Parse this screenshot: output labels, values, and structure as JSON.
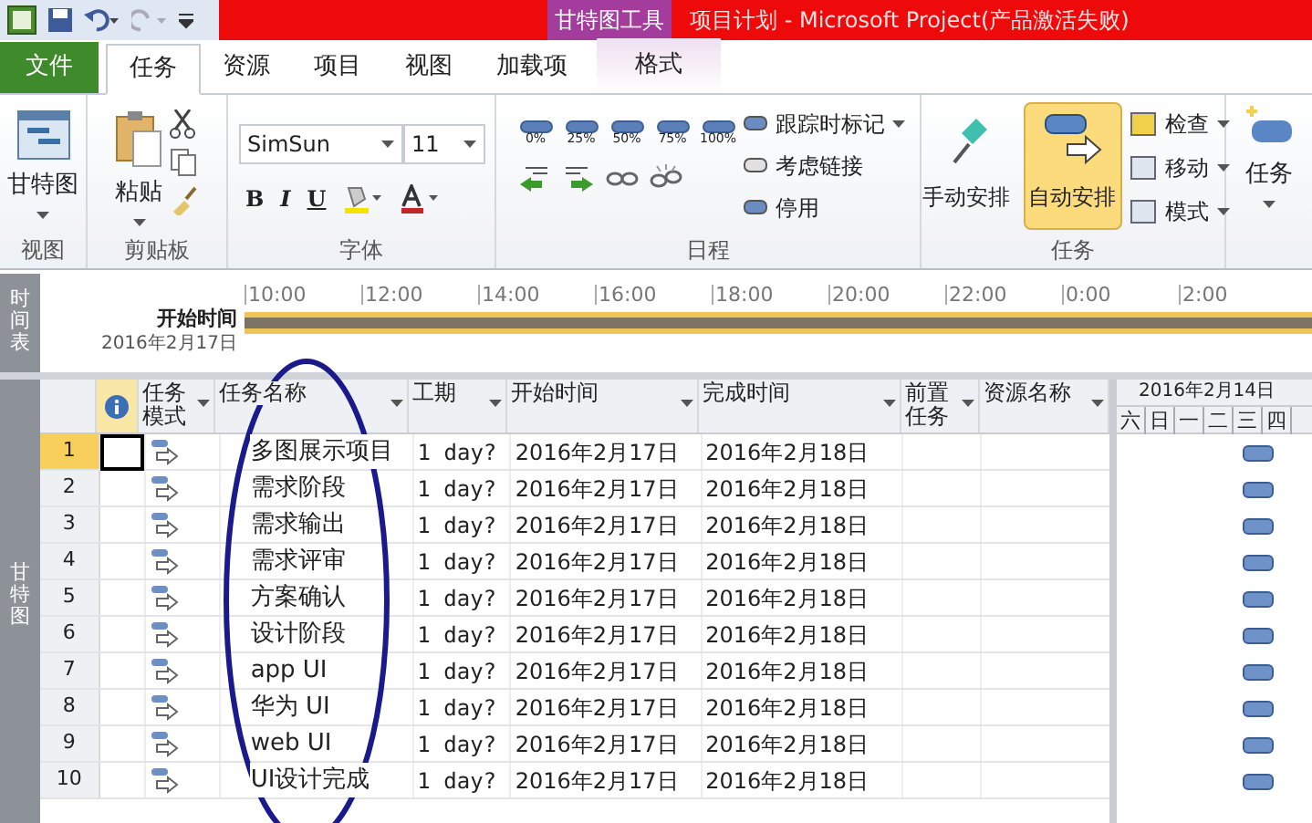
{
  "window": {
    "tool_tab": "甘特图工具",
    "title": "项目计划 - Microsoft Project(产品激活失败)"
  },
  "tabs": [
    {
      "label": "文件",
      "kind": "file",
      "selected": false
    },
    {
      "label": "任务",
      "kind": "tab",
      "selected": true
    },
    {
      "label": "资源",
      "kind": "tab",
      "selected": false
    },
    {
      "label": "项目",
      "kind": "tab",
      "selected": false
    },
    {
      "label": "视图",
      "kind": "tab",
      "selected": false
    },
    {
      "label": "加载项",
      "kind": "tab",
      "selected": false
    },
    {
      "label": "格式",
      "kind": "tool",
      "selected": false
    }
  ],
  "ribbon_groups": [
    {
      "kind": "view",
      "label": "视图",
      "button": "甘特图"
    },
    {
      "kind": "clipboard",
      "label": "剪贴板",
      "button": "粘贴"
    },
    {
      "kind": "font",
      "label": "字体",
      "font_family": "SimSun",
      "font_size": "11",
      "format_buttons": [
        "B",
        "I",
        "U"
      ]
    },
    {
      "kind": "schedule",
      "label": "日程",
      "percent_buttons": [
        "0%",
        "25%",
        "50%",
        "75%",
        "100%"
      ],
      "commands": [
        "跟踪时标记",
        "考虑链接",
        "停用"
      ]
    },
    {
      "kind": "task",
      "label": "任务",
      "buttons": [
        {
          "label": "手动安排",
          "selected": false
        },
        {
          "label": "自动安排",
          "selected": true
        }
      ],
      "commands": [
        "检查",
        "移动",
        "模式"
      ]
    },
    {
      "kind": "insert",
      "button": "任务"
    }
  ],
  "timeline": {
    "side_label": "时间表",
    "start_label": "开始时间",
    "start_date": "2016年2月17日",
    "ticks": [
      "10:00",
      "12:00",
      "14:00",
      "16:00",
      "18:00",
      "20:00",
      "22:00",
      "0:00",
      "2:00"
    ]
  },
  "table": {
    "side_label": "甘特图",
    "columns": [
      {
        "label": "任务模式"
      },
      {
        "label": "任务名称"
      },
      {
        "label": "工期"
      },
      {
        "label": "开始时间"
      },
      {
        "label": "完成时间"
      },
      {
        "label": "前置任务"
      },
      {
        "label": "资源名称"
      }
    ],
    "rows": [
      {
        "id": "1",
        "name": "多图展示项目",
        "duration": "1 day?",
        "start": "2016年2月17日",
        "finish": "2016年2月18日",
        "selected": true
      },
      {
        "id": "2",
        "name": "需求阶段",
        "duration": "1 day?",
        "start": "2016年2月17日",
        "finish": "2016年2月18日",
        "selected": false
      },
      {
        "id": "3",
        "name": "需求输出",
        "duration": "1 day?",
        "start": "2016年2月17日",
        "finish": "2016年2月18日",
        "selected": false
      },
      {
        "id": "4",
        "name": "需求评审",
        "duration": "1 day?",
        "start": "2016年2月17日",
        "finish": "2016年2月18日",
        "selected": false
      },
      {
        "id": "5",
        "name": "方案确认",
        "duration": "1 day?",
        "start": "2016年2月17日",
        "finish": "2016年2月18日",
        "selected": false
      },
      {
        "id": "6",
        "name": "设计阶段",
        "duration": "1 day?",
        "start": "2016年2月17日",
        "finish": "2016年2月18日",
        "selected": false
      },
      {
        "id": "7",
        "name": "app UI",
        "duration": "1 day?",
        "start": "2016年2月17日",
        "finish": "2016年2月18日",
        "selected": false
      },
      {
        "id": "8",
        "name": "华为 UI",
        "duration": "1 day?",
        "start": "2016年2月17日",
        "finish": "2016年2月18日",
        "selected": false
      },
      {
        "id": "9",
        "name": "web UI",
        "duration": "1 day?",
        "start": "2016年2月17日",
        "finish": "2016年2月18日",
        "selected": false
      },
      {
        "id": "10",
        "name": "UI设计完成",
        "duration": "1 day?",
        "start": "2016年2月17日",
        "finish": "2016年2月18日",
        "selected": false
      }
    ]
  },
  "gantt": {
    "week": "2016年2月14日",
    "days": [
      "六",
      "日",
      "一",
      "二",
      "三",
      "四"
    ]
  }
}
